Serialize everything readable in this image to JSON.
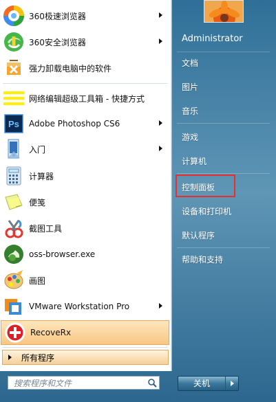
{
  "programs": [
    {
      "label": "360极速浏览器",
      "has_submenu": true,
      "icon": "360-speed-browser-icon",
      "color": "#45a8f3"
    },
    {
      "label": "360安全浏览器",
      "has_submenu": true,
      "icon": "360-safe-browser-icon",
      "color": "#48b849"
    },
    {
      "label": "强力卸载电脑中的软件",
      "has_submenu": false,
      "icon": "uninstall-box-icon",
      "color": "#f0a13c"
    },
    {
      "label": "网络编辑超级工具箱 - 快捷方式",
      "has_submenu": false,
      "icon": "toolbox-shortcut-icon",
      "color": "#ffef00"
    },
    {
      "label": "Adobe Photoshop CS6",
      "has_submenu": true,
      "icon": "photoshop-icon",
      "color": "#0b2a52"
    },
    {
      "label": "入门",
      "has_submenu": true,
      "icon": "getting-started-icon",
      "color": "#5d8fd0"
    },
    {
      "label": "计算器",
      "has_submenu": false,
      "icon": "calculator-icon",
      "color": "#9db9d8"
    },
    {
      "label": "便笺",
      "has_submenu": false,
      "icon": "sticky-notes-icon",
      "color": "#dfe76b"
    },
    {
      "label": "截图工具",
      "has_submenu": false,
      "icon": "snipping-tool-icon",
      "color": "#e23632"
    },
    {
      "label": "oss-browser.exe",
      "has_submenu": false,
      "icon": "oss-browser-icon",
      "color": "#3f8d3a"
    },
    {
      "label": "画图",
      "has_submenu": false,
      "icon": "paint-icon",
      "color": "#d9a15b"
    },
    {
      "label": "VMware Workstation Pro",
      "has_submenu": true,
      "icon": "vmware-icon",
      "color": "#f08c1a"
    },
    {
      "label": "RecoveRx",
      "has_submenu": false,
      "icon": "recoverx-icon",
      "color": "#d9212a",
      "highlighted": true
    }
  ],
  "all_programs_label": "所有程序",
  "search": {
    "placeholder": "搜索程序和文件"
  },
  "user": {
    "name": "Administrator"
  },
  "right_items": [
    "文档",
    "图片",
    "音乐",
    "游戏",
    "计算机",
    "控制面板",
    "设备和打印机",
    "默认程序",
    "帮助和支持"
  ],
  "shutdown_label": "关机",
  "colors": {
    "highlight_border": "#e7a85c",
    "red_box": "#ea2d2d",
    "pane_blue": "#3b7aa1"
  }
}
